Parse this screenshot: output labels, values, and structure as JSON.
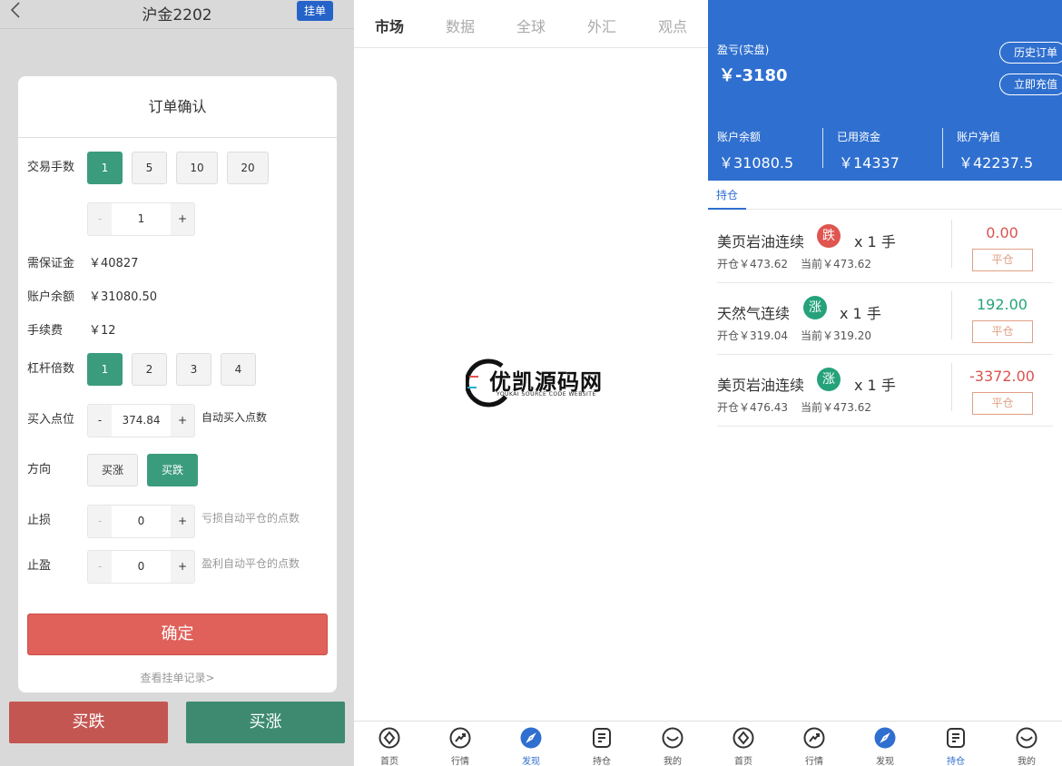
{
  "left": {
    "title": "沪金2202",
    "pending_btn": "挂单",
    "modal_title": "订单确认",
    "lots_label": "交易手数",
    "lots_options": [
      "1",
      "5",
      "10",
      "20"
    ],
    "lots_selected": "1",
    "lots_stepper": {
      "minus": "-",
      "value": "1",
      "plus": "+"
    },
    "margin_label": "需保证金",
    "margin_value": "￥40827",
    "balance_label": "账户余额",
    "balance_value": "￥31080.50",
    "fee_label": "手续费",
    "fee_value": "￥12",
    "leverage_label": "杠杆倍数",
    "leverage_options": [
      "1",
      "2",
      "3",
      "4"
    ],
    "leverage_selected": "1",
    "entry_label": "买入点位",
    "entry_stepper": {
      "minus": "-",
      "value": "374.84",
      "plus": "+"
    },
    "entry_hint": "自动买入点数",
    "direction_label": "方向",
    "direction_options": [
      "买涨",
      "买跌"
    ],
    "direction_selected": "买跌",
    "stoploss_label": "止损",
    "stoploss_stepper": {
      "minus": "-",
      "value": "0",
      "plus": "+"
    },
    "stoploss_hint": "亏损自动平仓的点数",
    "takeprofit_label": "止盈",
    "takeprofit_stepper": {
      "minus": "-",
      "value": "0",
      "plus": "+"
    },
    "takeprofit_hint": "盈利自动平仓的点数",
    "confirm_btn": "确定",
    "records_link": "查看挂单记录>",
    "buy_down_btn": "买跌",
    "buy_up_btn": "买涨"
  },
  "mid": {
    "tabs": [
      "市场",
      "数据",
      "全球",
      "外汇",
      "观点"
    ],
    "active_tab": "市场",
    "watermark_cn": "优凯源码网",
    "watermark_en": "YOUKAI SOURCE CODE WEBSITE"
  },
  "right": {
    "pl_label": "盈亏(实盘)",
    "pl_value": "￥-3180",
    "history_btn": "历史订单",
    "recharge_btn": "立即充值",
    "stats": [
      {
        "label": "账户余额",
        "value": "￥31080.5"
      },
      {
        "label": "已用资金",
        "value": "￥14337"
      },
      {
        "label": "账户净值",
        "value": "￥42237.5"
      }
    ],
    "sub_tab": "持仓",
    "positions": [
      {
        "name": "美页岩油连续",
        "dir": "跌",
        "qty": "x 1 手",
        "open": "开仓￥473.62",
        "current": "当前￥473.62",
        "pnl": "0.00",
        "close": "平仓"
      },
      {
        "name": "天然气连续",
        "dir": "涨",
        "qty": "x 1 手",
        "open": "开仓￥319.04",
        "current": "当前￥319.20",
        "pnl": "192.00",
        "close": "平仓"
      },
      {
        "name": "美页岩油连续",
        "dir": "涨",
        "qty": "x 1 手",
        "open": "开仓￥476.43",
        "current": "当前￥473.62",
        "pnl": "-3372.00",
        "close": "平仓"
      }
    ]
  },
  "nav": {
    "items": [
      "首页",
      "行情",
      "发现",
      "持仓",
      "我的"
    ],
    "mid_active": "发现",
    "right_active": "持仓"
  },
  "colors": {
    "green": "#3b9c7d",
    "red": "#e0605a",
    "blue": "#2f6fcf",
    "rise": "#26a27b",
    "fall": "#e0554f"
  }
}
